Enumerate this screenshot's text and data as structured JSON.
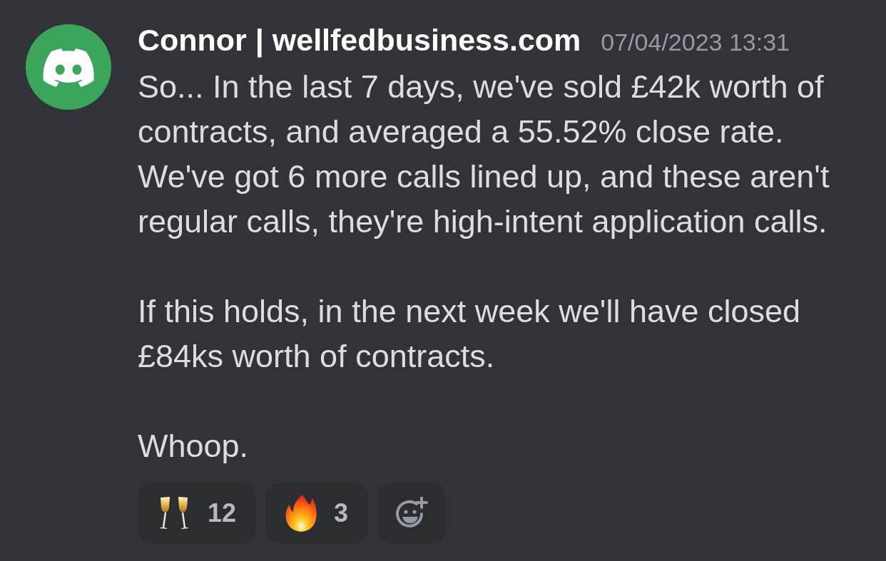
{
  "message": {
    "author": "Connor | wellfedbusiness.com",
    "timestamp": "07/04/2023 13:31",
    "paragraphs": [
      {
        "lines": [
          "So... In the last 7 days, we've sold £42k worth of",
          "contracts, and averaged a 55.52% close rate.",
          "We've got 6 more calls lined up, and these aren't",
          "regular calls, they're high-intent application calls."
        ]
      },
      {
        "lines": [
          "If this holds, in the next week we'll have closed",
          "£84ks worth of contracts."
        ]
      },
      {
        "lines": [
          "Whoop."
        ]
      }
    ]
  },
  "reactions": [
    {
      "kind": "champagne",
      "count": "12",
      "selected": false
    },
    {
      "kind": "fire",
      "count": "3",
      "selected": false
    }
  ]
}
